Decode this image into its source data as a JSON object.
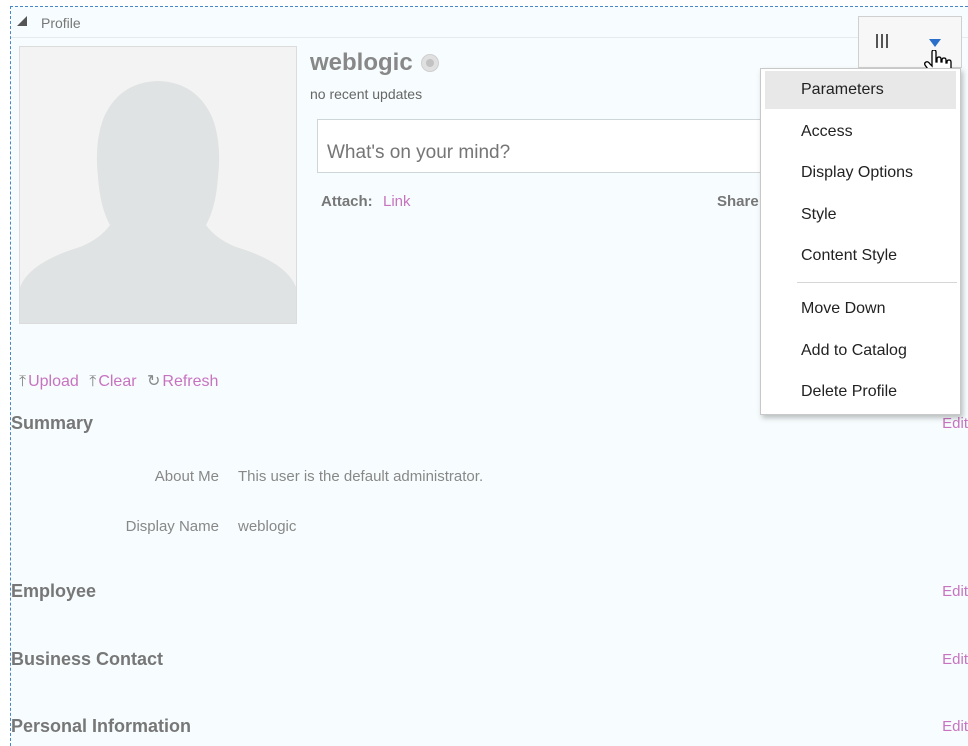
{
  "panel": {
    "title": "Profile"
  },
  "profile": {
    "username": "weblogic",
    "recent_updates": "no recent updates",
    "post_placeholder": "What's on your mind?",
    "attach_label": "Attach:",
    "attach_link": "Link",
    "share_label": "Share"
  },
  "photo_actions": [
    {
      "label": "Upload",
      "icon": "upload-icon"
    },
    {
      "label": "Clear",
      "icon": "upload-icon"
    },
    {
      "label": "Refresh",
      "icon": "refresh-icon"
    }
  ],
  "sections": {
    "summary": {
      "title": "Summary",
      "edit": "Edit",
      "about_label": "About Me",
      "about_value": "This user is the default administrator.",
      "display_label": "Display Name",
      "display_value": "weblogic"
    },
    "employee": {
      "title": "Employee",
      "edit": "Edit"
    },
    "business": {
      "title": "Business Contact",
      "edit": "Edit"
    },
    "personal": {
      "title": "Personal Information",
      "edit": "Edit"
    }
  },
  "menu": {
    "items": [
      "Parameters",
      "Access",
      "Display Options",
      "Style",
      "Content Style",
      "Move Down",
      "Add to Catalog",
      "Delete Profile"
    ]
  },
  "colors": {
    "link": "#c773c0",
    "accent": "#2a6fc9",
    "frame_border": "#4a86c5",
    "background": "#f7fdfe"
  }
}
